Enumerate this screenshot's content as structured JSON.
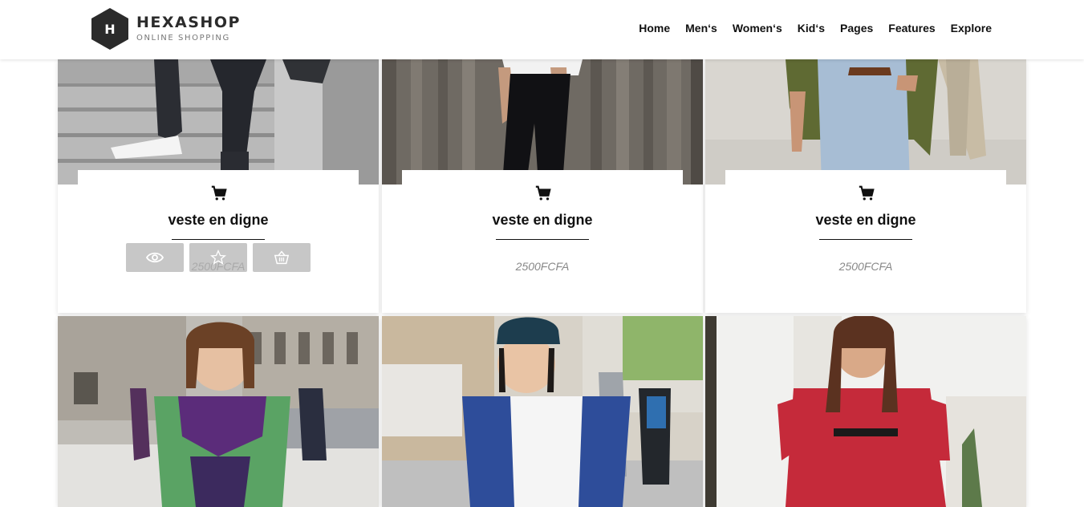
{
  "header": {
    "logo_letter": "H",
    "brand": "HEXASHOP",
    "tagline": "ONLINE SHOPPING",
    "nav": [
      "Home",
      "Men‘s",
      "Women‘s",
      "Kid‘s",
      "Pages",
      "Features",
      "Explore"
    ]
  },
  "products": [
    {
      "title": "veste en digne",
      "price": "2500FCFA",
      "icon": "cart-icon"
    },
    {
      "title": "veste en digne",
      "price": "2500FCFA",
      "icon": "cart-icon"
    },
    {
      "title": "veste en digne",
      "price": "2500FCFA",
      "icon": "cart-icon"
    }
  ],
  "hover_actions": [
    "eye-icon",
    "star-icon",
    "basket-icon"
  ],
  "colors": {
    "logo_hex": "#2b2b2b",
    "text": "#111111",
    "price": "#888888"
  }
}
